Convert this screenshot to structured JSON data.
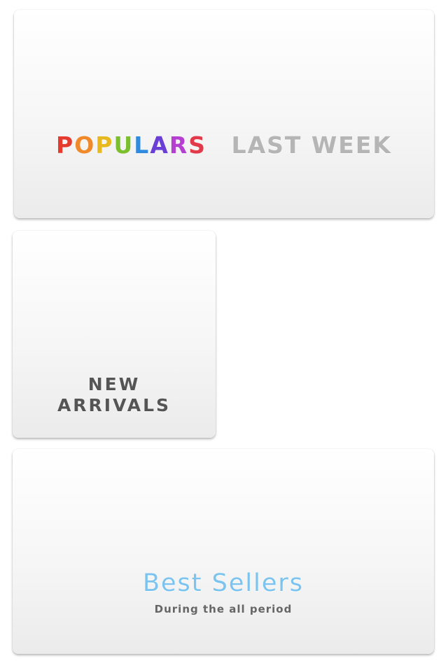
{
  "populars_card": {
    "title_letters": [
      {
        "char": "P",
        "color": "#e53a2e"
      },
      {
        "char": "O",
        "color": "#f0892a"
      },
      {
        "char": "P",
        "color": "#e8b81f"
      },
      {
        "char": "U",
        "color": "#7cbf2c"
      },
      {
        "char": "L",
        "color": "#2f8be0"
      },
      {
        "char": "A",
        "color": "#6a3fd6"
      },
      {
        "char": "R",
        "color": "#b43fd0"
      },
      {
        "char": "S",
        "color": "#e23a4a"
      }
    ],
    "subtitle": "LAST WEEK"
  },
  "new_arrivals_card": {
    "line1": "NEW",
    "line2": "ARRIVALS"
  },
  "best_sellers_card": {
    "title": "Best Sellers",
    "subtitle": "During the all period"
  },
  "colors": {
    "gray_text": "#b5b5b5",
    "dark_text": "#555555",
    "blue_text": "#7cc4ef"
  }
}
